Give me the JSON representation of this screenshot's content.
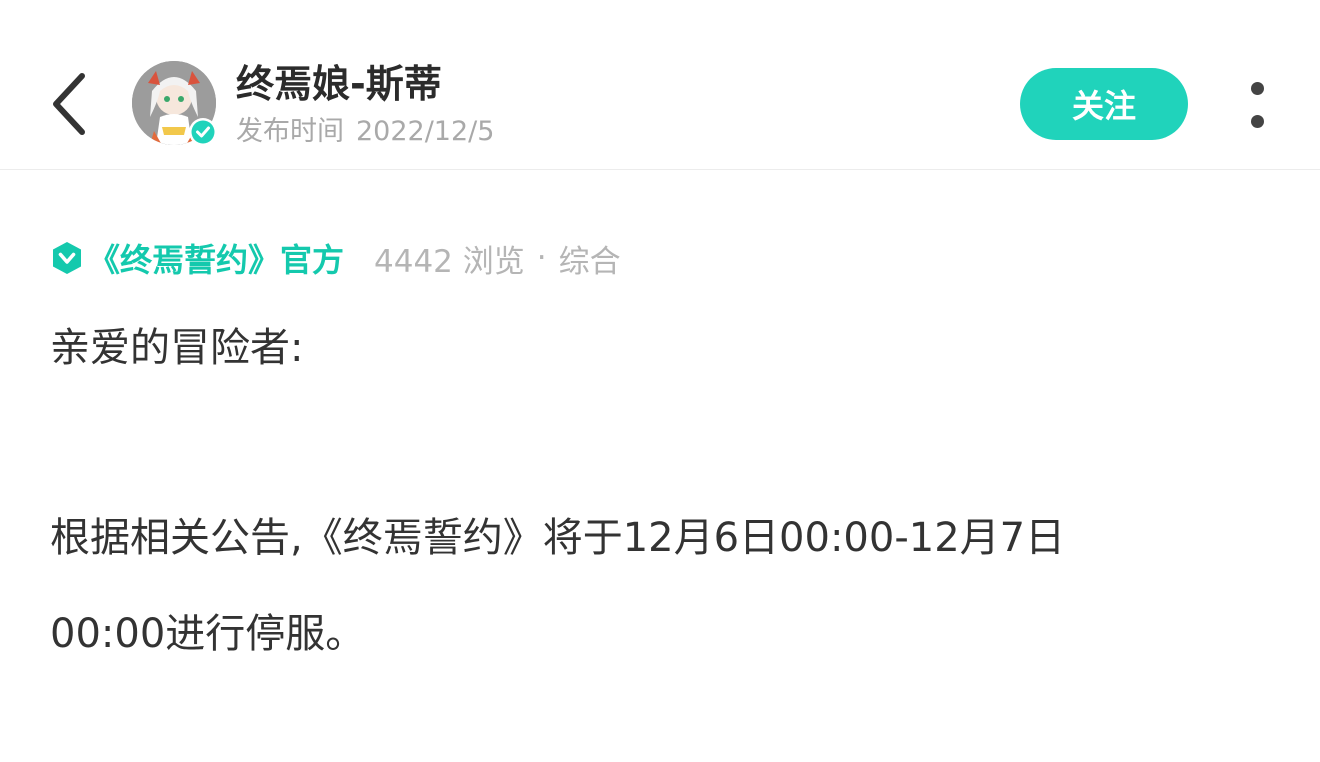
{
  "header": {
    "author_name": "终焉娘-斯蒂",
    "publish_label": "发布时间",
    "publish_date": "2022/12/5",
    "follow_label": "关注",
    "icons": {
      "back": "chevron-left-icon",
      "verified": "verified-check-icon",
      "more": "more-vertical-icon"
    }
  },
  "meta": {
    "official_label": "《终焉誓约》官方",
    "views": "4442 浏览",
    "separator": "·",
    "category": "综合",
    "icon": "shield-heart-icon"
  },
  "post": {
    "greeting": "亲爱的冒险者:",
    "lines": [
      "根据相关公告,《终焉誓约》将于12月6日00:00-12月7日",
      "00:00进行停服。"
    ]
  },
  "colors": {
    "accent": "#20d3bb",
    "official_text": "#14c9ad",
    "muted": "#a9a9a9",
    "body_text": "#333333"
  }
}
